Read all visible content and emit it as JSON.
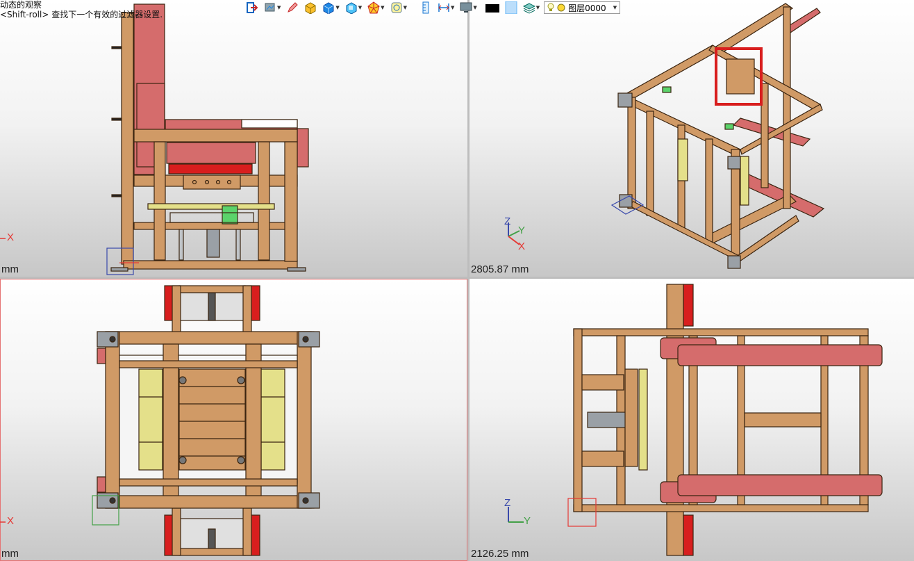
{
  "hint": {
    "line1": "动态的观察",
    "line2": "<Shift-roll> 查找下一个有效的过滤器设置."
  },
  "toolbar": {
    "buttons": [
      {
        "name": "exit-icon",
        "color": "#1565c0"
      },
      {
        "name": "render-mode-icon",
        "color": "#455a64"
      },
      {
        "name": "pencil-icon",
        "color": "#e53935"
      },
      {
        "name": "box-yellow-icon",
        "color": "#fbc02d"
      },
      {
        "name": "cube-blue-icon",
        "color": "#1e88e5"
      },
      {
        "name": "cube-outline-icon",
        "color": "#0277bd"
      },
      {
        "name": "polyhedron-icon",
        "color": "#f9a825"
      },
      {
        "name": "layer-display-icon",
        "color": "#607d8b"
      },
      {
        "name": "ruler-vertical-icon",
        "color": "#2196f3"
      },
      {
        "name": "ruler-horizontal-icon",
        "color": "#1976d2"
      },
      {
        "name": "monitor-icon",
        "color": "#546e7a"
      },
      {
        "name": "color-swatch-black-icon",
        "color": "#000000"
      },
      {
        "name": "color-swatch-blue-icon",
        "color": "#bbdefb"
      },
      {
        "name": "layers-stack-icon",
        "color": "#26a69a"
      }
    ],
    "layer_selector": {
      "value": "图层0000"
    }
  },
  "viewports": {
    "top_left": {
      "measure": "mm",
      "axis_x": "X"
    },
    "top_right": {
      "measure": "2805.87 mm",
      "axis_x": "X",
      "axis_y": "Y",
      "axis_z": "Z"
    },
    "bottom_left": {
      "measure": "mm",
      "axis_x": "X"
    },
    "bottom_right": {
      "measure": "2126.25 mm",
      "axis_y": "Y",
      "axis_z": "Z"
    }
  },
  "colors": {
    "wood": "#d09a66",
    "wood_edge": "#3a2410",
    "cushion": "#d56c6c",
    "red_part": "#d81e1e",
    "yellow_pad": "#e4e08a",
    "green_part": "#5bd36b",
    "steel": "#9aa0a6"
  }
}
